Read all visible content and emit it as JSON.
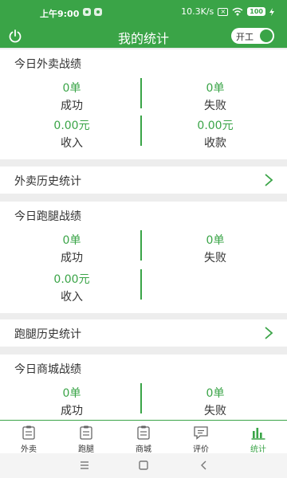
{
  "status_bar": {
    "time": "上午9:00",
    "network_speed": "10.3K/s",
    "sim_label": "×",
    "battery": "100"
  },
  "header": {
    "title": "我的统计",
    "toggle_label": "开工"
  },
  "takeaway_today": {
    "title": "今日外卖战绩",
    "success_value": "0单",
    "success_label": "成功",
    "fail_value": "0单",
    "fail_label": "失败",
    "income_value": "0.00元",
    "income_label": "收入",
    "collect_value": "0.00元",
    "collect_label": "收款"
  },
  "takeaway_history": {
    "label": "外卖历史统计"
  },
  "errand_today": {
    "title": "今日跑腿战绩",
    "success_value": "0单",
    "success_label": "成功",
    "fail_value": "0单",
    "fail_label": "失败",
    "income_value": "0.00元",
    "income_label": "收入"
  },
  "errand_history": {
    "label": "跑腿历史统计"
  },
  "mall_today": {
    "title": "今日商城战绩",
    "success_value": "0单",
    "success_label": "成功",
    "fail_value": "0单",
    "fail_label": "失败"
  },
  "tabs": [
    {
      "label": "外卖",
      "icon": "clipboard-icon"
    },
    {
      "label": "跑腿",
      "icon": "clipboard-icon"
    },
    {
      "label": "商城",
      "icon": "clipboard-icon"
    },
    {
      "label": "评价",
      "icon": "comment-icon"
    },
    {
      "label": "统计",
      "icon": "bar-chart-icon",
      "active": true
    }
  ],
  "colors": {
    "accent": "#3aa447",
    "background": "#ededed",
    "text": "#333333"
  }
}
